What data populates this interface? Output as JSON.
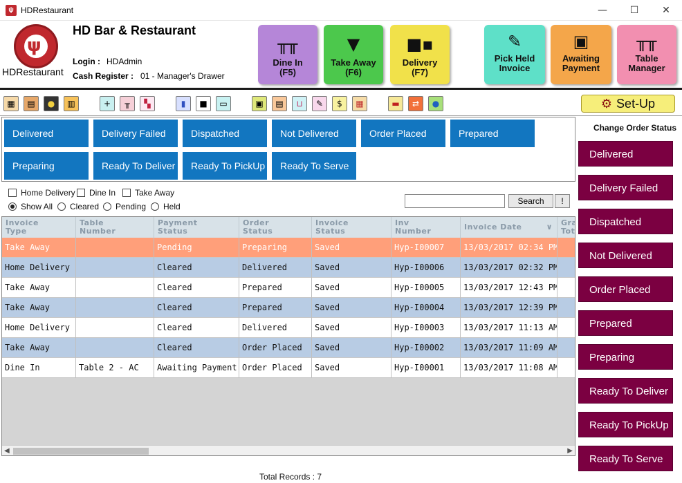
{
  "window": {
    "title": "HDRestaurant",
    "icon_text": "ψ"
  },
  "header": {
    "logo_text": "HDRestaurant",
    "company": "HD Bar & Restaurant",
    "login_label": "Login :",
    "login_value": "HDAdmin",
    "register_label": "Cash Register :",
    "register_value": "01 - Manager's Drawer"
  },
  "big_buttons": {
    "dine_in": {
      "line1": "Dine In",
      "line2": "(F5)",
      "icon": "table-icon"
    },
    "take_away": {
      "line1": "Take Away",
      "line2": "(F6)",
      "icon": "cup-icon"
    },
    "delivery": {
      "line1": "Delivery",
      "line2": "(F7)",
      "icon": "truck-icon"
    },
    "pick_held": {
      "line1": "Pick Held",
      "line2": "Invoice",
      "icon": "invoice-icon"
    },
    "awaiting": {
      "line1": "Awaiting",
      "line2": "Payment",
      "icon": "money-icon"
    },
    "table_manager": {
      "line1": "Table",
      "line2": "Manager",
      "icon": "table-icon"
    }
  },
  "toolbar": {
    "setup_label": "Set-Up"
  },
  "filter_buttons": [
    "Delivered",
    "Delivery Failed",
    "Dispatched",
    "Not Delivered",
    "Order Placed",
    "Prepared",
    "Preparing",
    "Ready To Deliver",
    "Ready To PickUp",
    "Ready To Serve"
  ],
  "checkboxes": [
    "Home Delivery",
    "Dine In",
    "Take Away"
  ],
  "radios": {
    "items": [
      "Show All",
      "Cleared",
      "Pending",
      "Held"
    ],
    "selected": "Show All"
  },
  "search": {
    "value": "",
    "button_label": "Search",
    "extra_label": "!"
  },
  "grid": {
    "columns": [
      {
        "line1": "Invoice",
        "line2": "Type"
      },
      {
        "line1": "Table",
        "line2": "Number"
      },
      {
        "line1": "Payment",
        "line2": "Status"
      },
      {
        "line1": "Order",
        "line2": "Status"
      },
      {
        "line1": "Invoice",
        "line2": "Status"
      },
      {
        "line1": "Inv",
        "line2": "Number"
      },
      {
        "line1": "Invoice Date",
        "line2": ""
      },
      {
        "line1": "Gra",
        "line2": "Tot"
      }
    ],
    "sort_indicator": "∨",
    "rows": [
      {
        "style": "orange",
        "cells": [
          "Take Away",
          "",
          "Pending",
          "Preparing",
          "Saved",
          "Hyp-I00007",
          "13/03/2017 02:34 PM"
        ]
      },
      {
        "style": "blue",
        "cells": [
          "Home Delivery",
          "",
          "Cleared",
          "Delivered",
          "Saved",
          "Hyp-I00006",
          "13/03/2017 02:32 PM"
        ]
      },
      {
        "style": "white",
        "cells": [
          "Take Away",
          "",
          "Cleared",
          "Prepared",
          "Saved",
          "Hyp-I00005",
          "13/03/2017 12:43 PM"
        ]
      },
      {
        "style": "blue",
        "cells": [
          "Take Away",
          "",
          "Cleared",
          "Prepared",
          "Saved",
          "Hyp-I00004",
          "13/03/2017 12:39 PM"
        ]
      },
      {
        "style": "white",
        "cells": [
          "Home Delivery",
          "",
          "Cleared",
          "Delivered",
          "Saved",
          "Hyp-I00003",
          "13/03/2017 11:13 AM"
        ]
      },
      {
        "style": "blue",
        "cells": [
          "Take Away",
          "",
          "Cleared",
          "Order Placed",
          "Saved",
          "Hyp-I00002",
          "13/03/2017 11:09 AM"
        ]
      },
      {
        "style": "white",
        "cells": [
          "Dine In",
          "Table 2 - AC",
          "Awaiting Payment",
          "Order Placed",
          "Saved",
          "Hyp-I00001",
          "13/03/2017 11:08 AM"
        ]
      }
    ]
  },
  "footer": {
    "total_records": "Total Records : 7"
  },
  "status_panel": {
    "title": "Change Order Status",
    "buttons": [
      "Delivered",
      "Delivery Failed",
      "Dispatched",
      "Not Delivered",
      "Order Placed",
      "Prepared",
      "Preparing",
      "Ready To Deliver",
      "Ready To PickUp",
      "Ready To Serve"
    ]
  }
}
